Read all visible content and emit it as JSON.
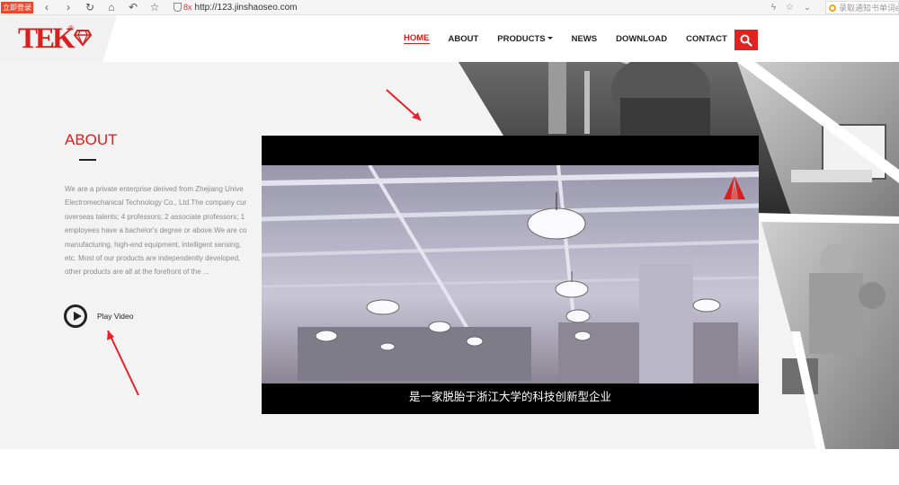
{
  "browser": {
    "login_badge": "立即登录",
    "back": "‹",
    "forward": "›",
    "reload": "↻",
    "home": "⌂",
    "undo": "↶",
    "star": "☆",
    "url_prefix": "8x",
    "url": "http://123.jinshaoseo.com",
    "right_icons": "ϟ ☆ ⌄",
    "ext_search": "录取通知书单词e"
  },
  "header": {
    "logo_text": "TEK",
    "logo_reg": "®",
    "nav": [
      {
        "label": "HOME",
        "active": true
      },
      {
        "label": "ABOUT",
        "active": false
      },
      {
        "label": "PRODUCTS",
        "active": false,
        "dropdown": true
      },
      {
        "label": "NEWS",
        "active": false
      },
      {
        "label": "DOWNLOAD",
        "active": false
      },
      {
        "label": "CONTACT",
        "active": false
      }
    ]
  },
  "about": {
    "title": "ABOUT",
    "text_lines": [
      "We are a private enterprise derived from Zhejiang Unive",
      "Electromechanical Technology Co., Ltd.The company cur",
      "overseas talents; 4 professors; 2 associate professors; 1",
      "employees have a bachelor's degree or above.We are co",
      "manufacturing, high-end equipment, intelligent sensing,",
      "etc. Most of our products are independently developed,",
      "other products are all at the forefront of the ..."
    ],
    "play_label": "Play Video"
  },
  "video": {
    "subtitle": "是一家脱胎于浙江大学的科技创新型企业"
  },
  "colors": {
    "brand_red": "#d8201f",
    "search_red": "#e0231e"
  }
}
